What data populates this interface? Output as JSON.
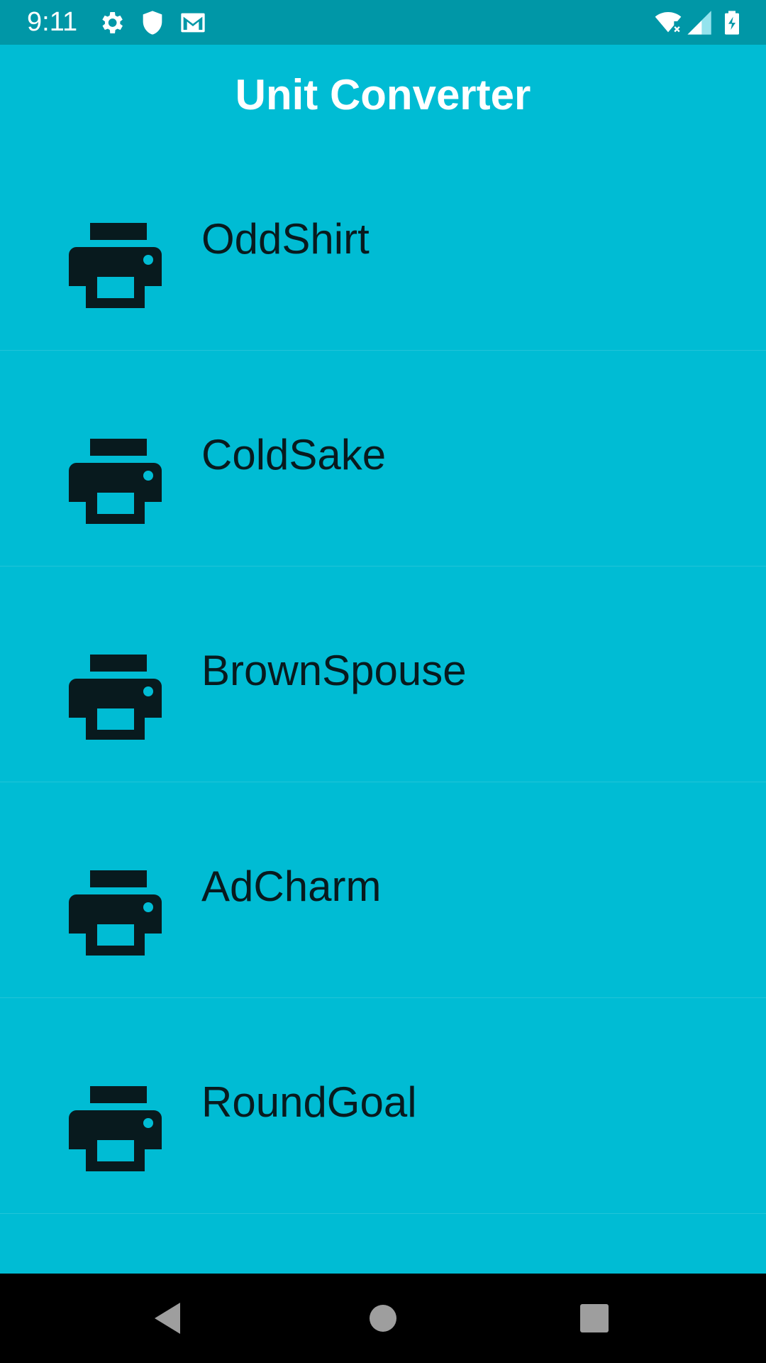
{
  "status_bar": {
    "time": "9:11",
    "icons_left": [
      "settings-icon",
      "shield-icon",
      "gmail-icon"
    ],
    "icons_right": [
      "wifi-off-icon",
      "cell-signal-icon",
      "battery-charging-icon"
    ]
  },
  "app_bar": {
    "title": "Unit Converter"
  },
  "list": {
    "items": [
      {
        "label": "OddShirt",
        "icon": "printer-icon"
      },
      {
        "label": "ColdSake",
        "icon": "printer-icon"
      },
      {
        "label": "BrownSpouse",
        "icon": "printer-icon"
      },
      {
        "label": "AdCharm",
        "icon": "printer-icon"
      },
      {
        "label": "RoundGoal",
        "icon": "printer-icon"
      }
    ]
  },
  "nav_bar": {
    "buttons": [
      "back-icon",
      "home-icon",
      "recents-icon"
    ]
  },
  "colors": {
    "background": "#00BCD4",
    "status_bar": "#0097A7",
    "title_text": "#FFFFFF",
    "item_text": "#081A1E",
    "icon_fill": "#081A1E",
    "nav_bar": "#000000"
  }
}
